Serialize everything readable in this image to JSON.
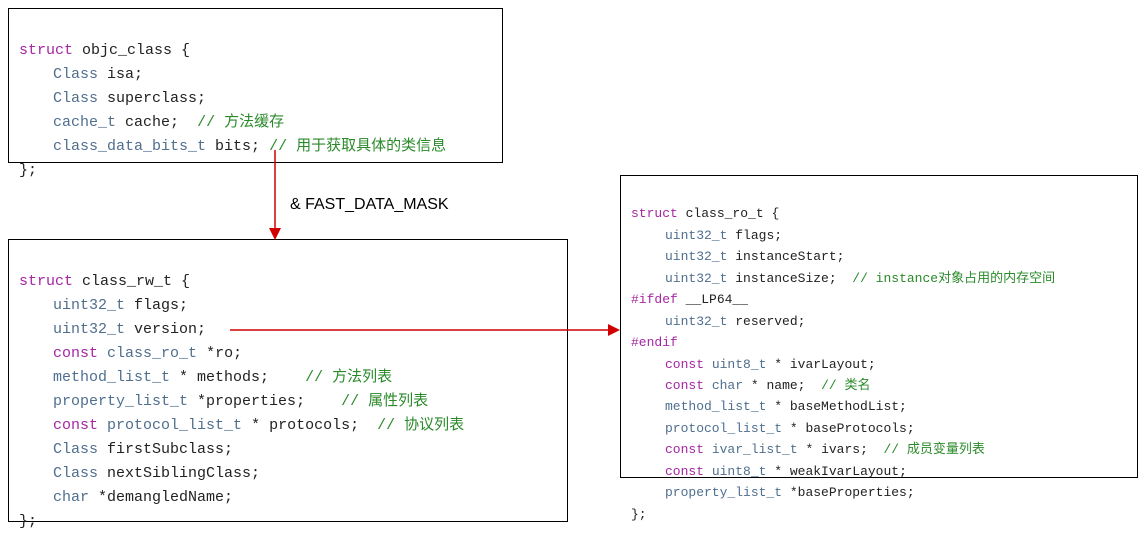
{
  "mask_label": "& FAST_DATA_MASK",
  "box1": {
    "l1_kw": "struct",
    "l1_name": "objc_class {",
    "l2_type": "Class",
    "l2_name": "isa;",
    "l3_type": "Class",
    "l3_name": "superclass;",
    "l4_type": "cache_t",
    "l4_name": "cache;",
    "l4_comment": "// 方法缓存",
    "l5_type": "class_data_bits_t",
    "l5_name": "bits;",
    "l5_comment": "// 用于获取具体的类信息",
    "l6": "};"
  },
  "box2": {
    "l1_kw": "struct",
    "l1_name": "class_rw_t {",
    "l2_type": "uint32_t",
    "l2_name": "flags;",
    "l3_type": "uint32_t",
    "l3_name": "version;",
    "l4_kw": "const",
    "l4_type": "class_ro_t",
    "l4_name": "*ro;",
    "l5_type": "method_list_t",
    "l5_name": "* methods;",
    "l5_comment": "// 方法列表",
    "l6_type": "property_list_t",
    "l6_name": "*properties;",
    "l6_comment": "// 属性列表",
    "l7_kw": "const",
    "l7_type": "protocol_list_t",
    "l7_name": "* protocols;",
    "l7_comment": "// 协议列表",
    "l8_type": "Class",
    "l8_name": "firstSubclass;",
    "l9_type": "Class",
    "l9_name": "nextSiblingClass;",
    "l10_type": "char",
    "l10_name": "*demangledName;",
    "l11": "};"
  },
  "box3": {
    "l1_kw": "struct",
    "l1_name": "class_ro_t {",
    "l2_type": "uint32_t",
    "l2_name": "flags;",
    "l3_type": "uint32_t",
    "l3_name": "instanceStart;",
    "l4_type": "uint32_t",
    "l4_name": "instanceSize;",
    "l4_comment": "// instance对象占用的内存空间",
    "l5_kw": "#ifdef",
    "l5_name": "__LP64__",
    "l6_type": "uint32_t",
    "l6_name": "reserved;",
    "l7_kw": "#endif",
    "l8_kw": "const",
    "l8_type": "uint8_t",
    "l8_name": "* ivarLayout;",
    "l9_kw": "const",
    "l9_type": "char",
    "l9_name": "* name;",
    "l9_comment": "// 类名",
    "l10_type": "method_list_t",
    "l10_name": "* baseMethodList;",
    "l11_type": "protocol_list_t",
    "l11_name": "* baseProtocols;",
    "l12_kw": "const",
    "l12_type": "ivar_list_t",
    "l12_name": "* ivars;",
    "l12_comment": "// 成员变量列表",
    "l13_kw": "const",
    "l13_type": "uint8_t",
    "l13_name": "* weakIvarLayout;",
    "l14_type": "property_list_t",
    "l14_name": "*baseProperties;",
    "l15": "};"
  }
}
